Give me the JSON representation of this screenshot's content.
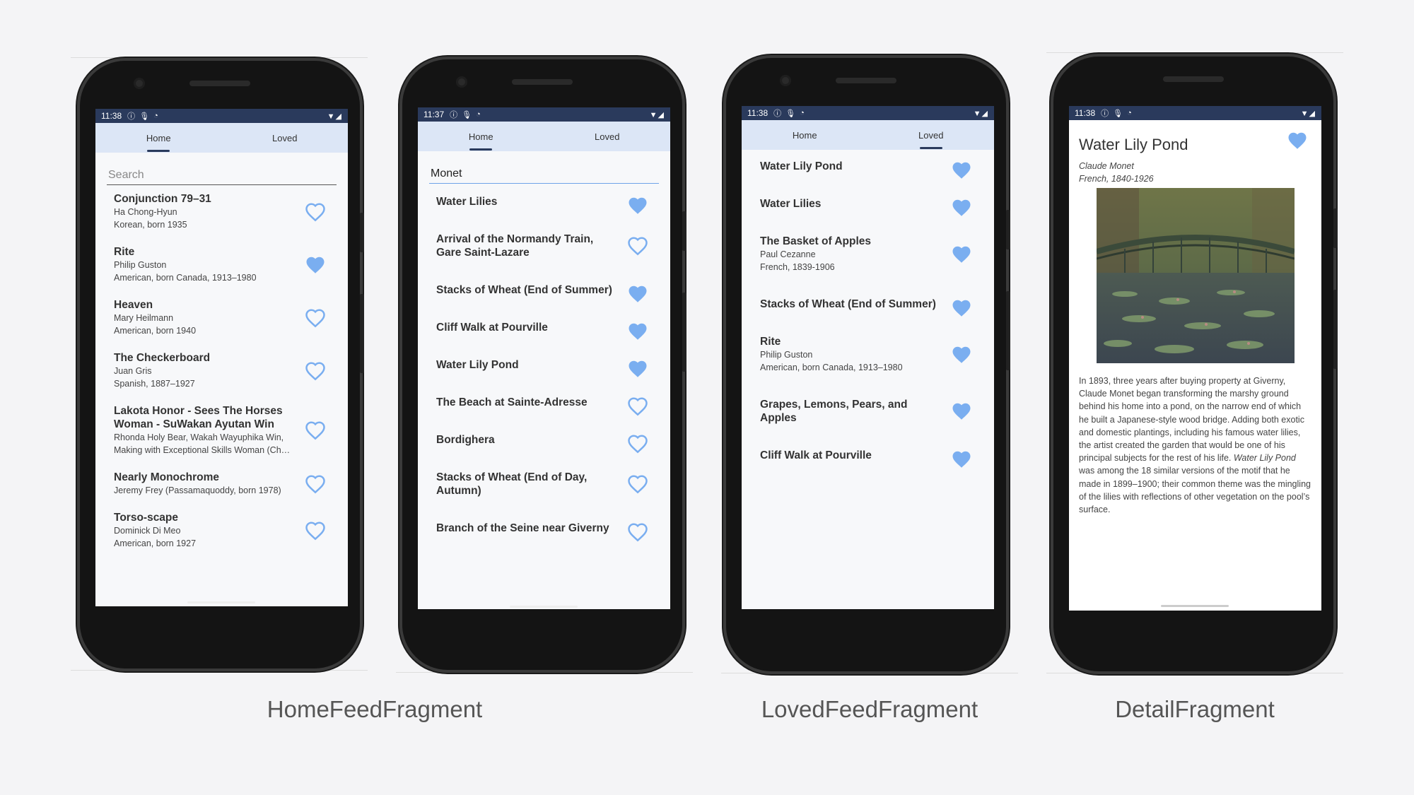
{
  "accent": "#7aaef0",
  "status_bar": {
    "icons": [
      "info-icon",
      "mic-icon",
      "sync-icon",
      "wifi-icon",
      "signal-icon"
    ]
  },
  "screens": [
    {
      "id": "home-default",
      "time": "11:38",
      "tabs": [
        {
          "label": "Home"
        },
        {
          "label": "Loved"
        }
      ],
      "active_tab": "Home",
      "search": {
        "placeholder": "Search",
        "value": ""
      },
      "items": [
        {
          "title": "Conjunction 79–31",
          "lines": [
            "Ha Chong-Hyun",
            "Korean, born 1935"
          ],
          "loved": false
        },
        {
          "title": "Rite",
          "lines": [
            "Philip Guston",
            "American, born Canada, 1913–1980"
          ],
          "loved": true
        },
        {
          "title": "Heaven",
          "lines": [
            "Mary Heilmann",
            "American, born 1940"
          ],
          "loved": false
        },
        {
          "title": "The Checkerboard",
          "lines": [
            "Juan Gris",
            "Spanish, 1887–1927"
          ],
          "loved": false
        },
        {
          "title": "Lakota Honor - Sees The Horses Woman - SuWakan Ayutan Win",
          "lines": [
            "Rhonda Holy Bear, Wakah Wayuphika Win,",
            "Making with Exceptional Skills Woman (Ch…"
          ],
          "loved": false
        },
        {
          "title": "Nearly Monochrome",
          "lines": [
            "Jeremy Frey (Passamaquoddy, born 1978)"
          ],
          "loved": false
        },
        {
          "title": "Torso-scape",
          "lines": [
            "Dominick Di Meo",
            "American, born 1927"
          ],
          "loved": false
        }
      ]
    },
    {
      "id": "home-search",
      "time": "11:37",
      "tabs": [
        {
          "label": "Home"
        },
        {
          "label": "Loved"
        }
      ],
      "active_tab": "Home",
      "search": {
        "placeholder": "Search",
        "value": "Monet"
      },
      "items": [
        {
          "title": "Water Lilies",
          "lines": [],
          "loved": true
        },
        {
          "title": "Arrival of the Normandy Train, Gare Saint-Lazare",
          "lines": [],
          "loved": false
        },
        {
          "title": "Stacks of Wheat (End of Summer)",
          "lines": [],
          "loved": true
        },
        {
          "title": "Cliff Walk at Pourville",
          "lines": [],
          "loved": true
        },
        {
          "title": "Water Lily Pond",
          "lines": [],
          "loved": true
        },
        {
          "title": "The Beach at Sainte-Adresse",
          "lines": [],
          "loved": false
        },
        {
          "title": "Bordighera",
          "lines": [],
          "loved": false
        },
        {
          "title": "Stacks of Wheat (End of Day, Autumn)",
          "lines": [],
          "loved": false
        },
        {
          "title": "Branch of the Seine near Giverny",
          "lines": [],
          "loved": false
        }
      ]
    },
    {
      "id": "loved",
      "time": "11:38",
      "tabs": [
        {
          "label": "Home"
        },
        {
          "label": "Loved"
        }
      ],
      "active_tab": "Loved",
      "items": [
        {
          "title": "Water Lily Pond",
          "lines": [],
          "loved": true
        },
        {
          "title": "Water Lilies",
          "lines": [],
          "loved": true
        },
        {
          "title": "The Basket of Apples",
          "lines": [
            "Paul Cezanne",
            "French, 1839-1906"
          ],
          "loved": true
        },
        {
          "title": "Stacks of Wheat (End of Summer)",
          "lines": [],
          "loved": true
        },
        {
          "title": "Rite",
          "lines": [
            "Philip Guston",
            "American, born Canada, 1913–1980"
          ],
          "loved": true
        },
        {
          "title": "Grapes, Lemons, Pears, and Apples",
          "lines": [],
          "loved": true
        },
        {
          "title": "Cliff Walk at Pourville",
          "lines": [],
          "loved": true
        }
      ]
    },
    {
      "id": "detail",
      "time": "11:38",
      "title": "Water Lily Pond",
      "loved": true,
      "artist": "Claude Monet",
      "artist_info": "French, 1840-1926",
      "description_part1": "In 1893, three years after buying property at Giverny, Claude Monet began transforming the marshy ground behind his home into a pond, on the narrow end of which he built a Japanese-style wood bridge. Adding both exotic and domestic plantings, including his famous water lilies, the artist created the garden that would be one of his principal subjects for the rest of his life.",
      "description_italic": "Water Lily Pond",
      "description_part2": "was among the 18 similar versions of the motif that he made in 1899–1900; their common theme was the mingling of the lilies with reflections of other vegetation on the pool’s surface."
    }
  ],
  "captions": {
    "home": "HomeFeedFragment",
    "loved": "LovedFeedFragment",
    "detail": "DetailFragment"
  }
}
